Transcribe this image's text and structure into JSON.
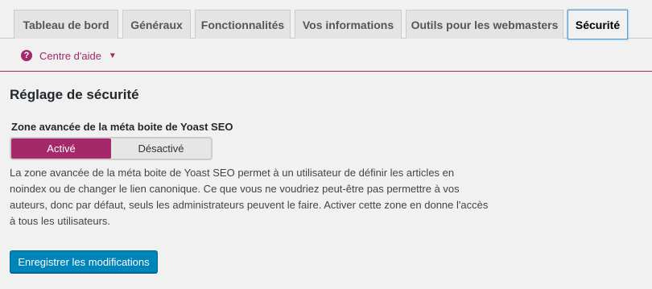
{
  "tabs": [
    {
      "label": "Tableau de bord",
      "active": false
    },
    {
      "label": "Généraux",
      "active": false
    },
    {
      "label": "Fonctionnalités",
      "active": false
    },
    {
      "label": "Vos informations",
      "active": false
    },
    {
      "label": "Outils pour les webmasters",
      "active": false
    },
    {
      "label": "Sécurité",
      "active": true
    }
  ],
  "help": {
    "label": "Centre d'aide",
    "icon": "question-circle-icon",
    "caret_icon": "caret-down-icon"
  },
  "section": {
    "title": "Réglage de sécurité"
  },
  "advanced_metabox": {
    "label": "Zone avancée de la méta boite de Yoast SEO",
    "options": [
      "Activé",
      "Désactivé"
    ],
    "selected": "Activé",
    "description": "La zone avancée de la méta boite de Yoast SEO permet à un utilisateur de définir les articles en noindex ou de changer le lien canonique. Ce que vous ne voudriez peut-être pas permettre à vos auteurs, donc par défaut, seuls les administrateurs peuvent le faire. Activer cette zone en donne l'accès à tous les utilisateurs."
  },
  "save_button": {
    "label": "Enregistrer les modifications"
  },
  "colors": {
    "accent": "#a4286a",
    "primary_button": "#0085ba",
    "background": "#f1f1f1"
  }
}
